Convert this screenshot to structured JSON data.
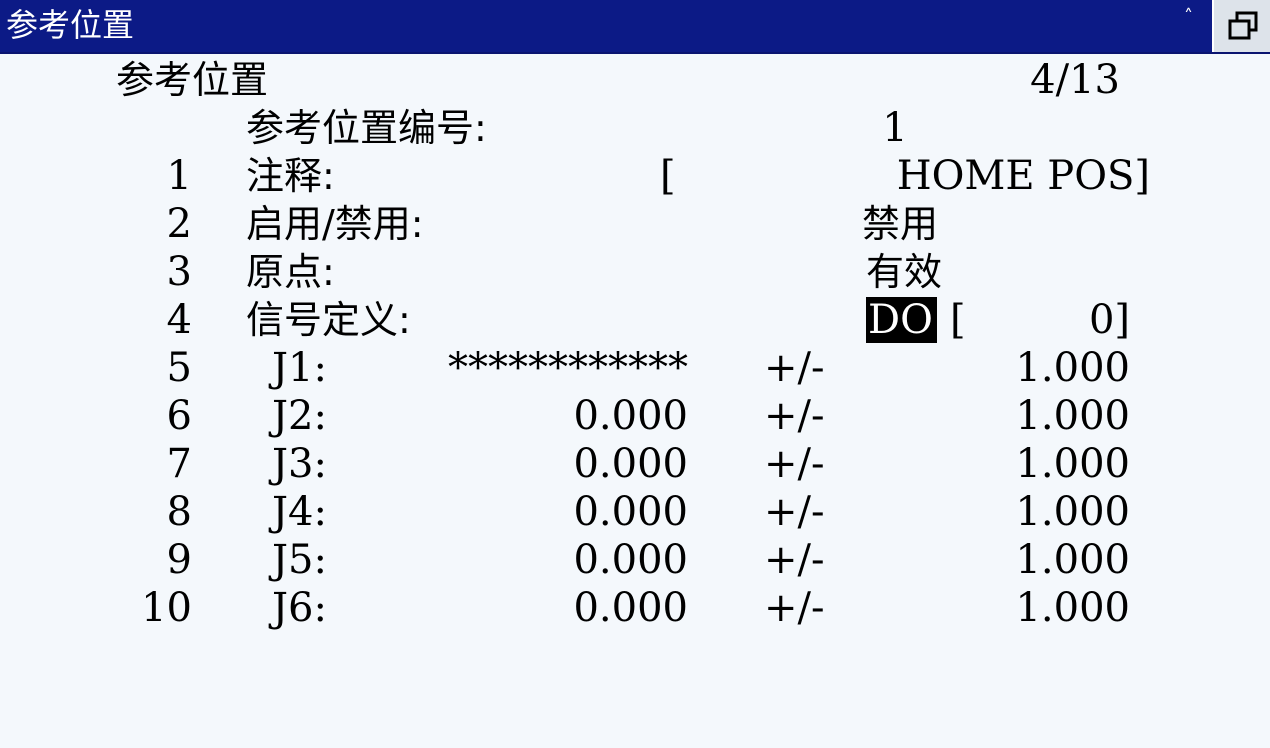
{
  "window": {
    "title": "参考位置",
    "caret_icon": "caret-up-icon",
    "restore_icon": "window-restore-icon"
  },
  "screen": {
    "heading": "参考位置",
    "page": "4/13",
    "ref_no_label": "参考位置编号:",
    "ref_no_value": "1"
  },
  "items": [
    {
      "num": "1",
      "label": "注释:",
      "bracket_open": "[",
      "value": "HOME POS]"
    },
    {
      "num": "2",
      "label": "启用/禁用:",
      "value": "禁用"
    },
    {
      "num": "3",
      "label": "原点:",
      "value": "有效"
    },
    {
      "num": "4",
      "label": "信号定义:",
      "signal_type": "DO",
      "signal_bracket": "[",
      "value": "0]"
    }
  ],
  "joints": [
    {
      "num": "5",
      "label": "J1:",
      "value": "************",
      "tol_sign": "+/-",
      "tolerance": "1.000"
    },
    {
      "num": "6",
      "label": "J2:",
      "value": "0.000",
      "tol_sign": "+/-",
      "tolerance": "1.000"
    },
    {
      "num": "7",
      "label": "J3:",
      "value": "0.000",
      "tol_sign": "+/-",
      "tolerance": "1.000"
    },
    {
      "num": "8",
      "label": "J4:",
      "value": "0.000",
      "tol_sign": "+/-",
      "tolerance": "1.000"
    },
    {
      "num": "9",
      "label": "J5:",
      "value": "0.000",
      "tol_sign": "+/-",
      "tolerance": "1.000"
    },
    {
      "num": "10",
      "label": "J6:",
      "value": "0.000",
      "tol_sign": "+/-",
      "tolerance": "1.000"
    }
  ],
  "colors": {
    "titlebar": "#0c1a86",
    "background": "#f4f8fc",
    "text": "#000000",
    "highlight_bg": "#000000",
    "highlight_fg": "#ffffff"
  }
}
